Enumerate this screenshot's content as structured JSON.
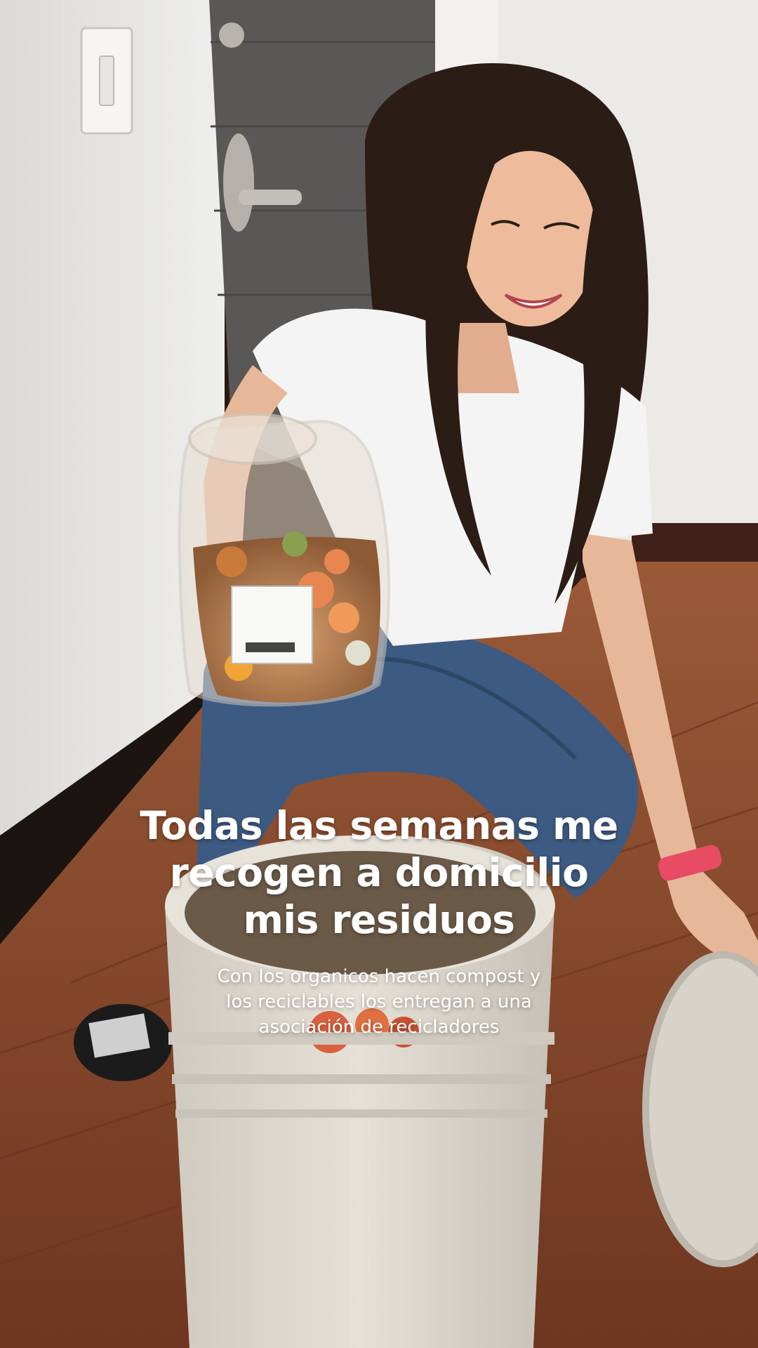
{
  "caption": {
    "title_lines": [
      "Todas las semanas me",
      "recogen a domicilio",
      "mis residuos"
    ],
    "subtitle_lines": [
      "Con los organicos hacen compost y",
      "los reciclables los entregan a una",
      "asociación de recicladores"
    ]
  },
  "colors": {
    "wall": "#e9e8e6",
    "door": "#5c5a58",
    "floor": "#8a4a2c",
    "shirt": "#f4f4f4",
    "jeans": "#3d5a82",
    "hair": "#2b1d16",
    "bucket": "#dcd6cc",
    "wristband": "#e84b64",
    "caption_text": "#ffffff"
  },
  "scene_objects": [
    "wall",
    "door",
    "light-switch",
    "door-handle",
    "floor",
    "woman",
    "jar-of-food-scraps",
    "white-bucket",
    "bucket-lid",
    "small-black-lid",
    "red-wristband"
  ]
}
